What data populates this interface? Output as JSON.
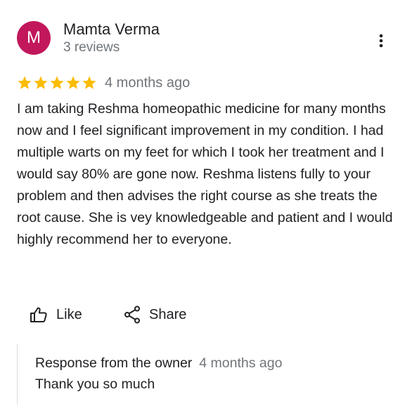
{
  "author": {
    "initial": "M",
    "name": "Mamta Verma",
    "reviews_count": "3 reviews",
    "avatar_color": "#c2185b"
  },
  "menu": {
    "icon": "more-vert-icon"
  },
  "rating": {
    "stars": 5,
    "max_stars": 5,
    "star_color": "#fbbc04",
    "date": "4 months ago"
  },
  "review": {
    "text": "I am taking Reshma homeopathic medicine for many months now and I feel significant improvement in my condition. I had multiple warts on my feet for which I took her treatment and I would say 80% are gone now. Reshma listens fully to your problem and then advises the right course as she treats the root cause.  She is vey knowledgeable and patient and I would highly recommend her to everyone."
  },
  "actions": {
    "like_label": "Like",
    "like_icon": "thumbs-up-icon",
    "share_label": "Share",
    "share_icon": "share-icon"
  },
  "owner_response": {
    "label": "Response from the owner",
    "date": "4 months ago",
    "text": "Thank you so much"
  }
}
